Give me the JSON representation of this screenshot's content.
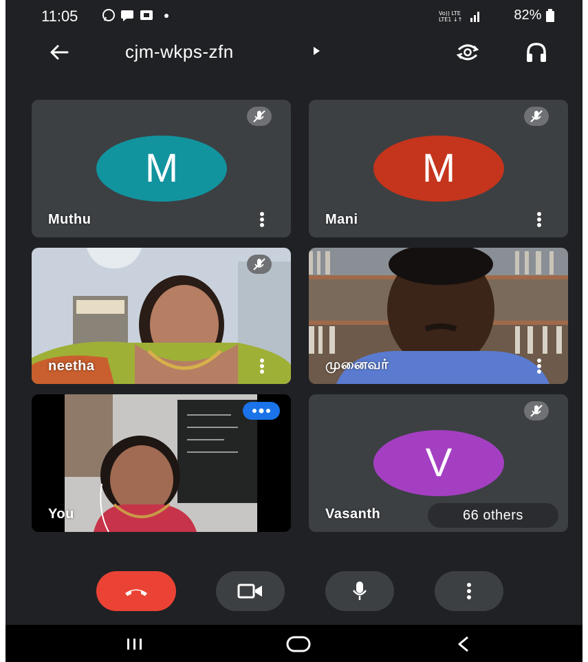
{
  "status_bar": {
    "time": "11:05",
    "left_icons": [
      "whatsapp-icon",
      "message-icon",
      "media-icon",
      "dot-icon"
    ],
    "right_text": "82%"
  },
  "header": {
    "meeting_code": "cjm-wkps-zfn",
    "icons": [
      "back-arrow-icon",
      "flip-camera-icon",
      "headphones-icon"
    ]
  },
  "participants": [
    {
      "name": "Muthu",
      "initial": "M",
      "avatar_color": "#12949f",
      "muted": true
    },
    {
      "name": "Mani",
      "initial": "M",
      "avatar_color": "#c5341c",
      "muted": true
    },
    {
      "name": "neetha",
      "video": true,
      "muted": true
    },
    {
      "name": "முனைவர்",
      "video": true,
      "muted": false
    },
    {
      "name": "You",
      "video": true,
      "speaking": true
    },
    {
      "name": "Vasanth",
      "initial": "V",
      "avatar_color": "#a43fc2",
      "muted": true
    }
  ],
  "others_chip": "66 others",
  "controls": {
    "end_call_color": "#ea4335",
    "buttons": [
      "end-call-icon",
      "camera-icon",
      "microphone-icon",
      "more-vert-icon"
    ]
  },
  "nav": [
    "recent-apps-icon",
    "home-icon",
    "back-icon"
  ]
}
